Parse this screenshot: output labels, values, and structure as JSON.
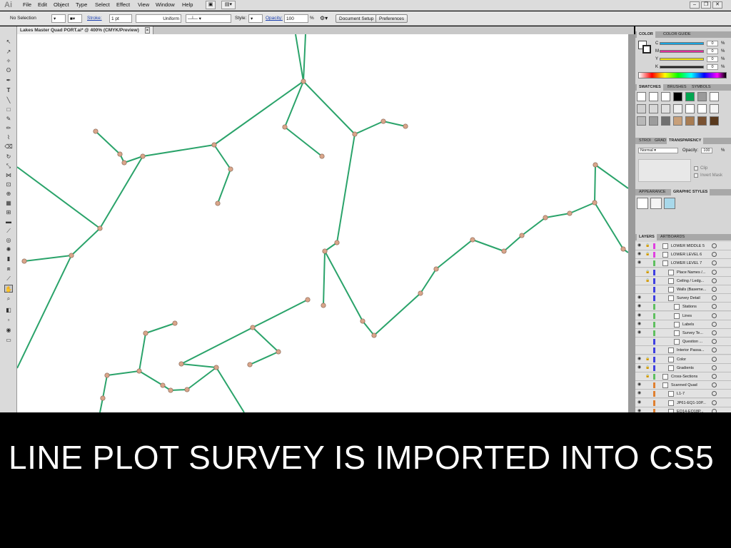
{
  "app": {
    "logo": "Ai"
  },
  "menubar": {
    "items": [
      "File",
      "Edit",
      "Object",
      "Type",
      "Select",
      "Effect",
      "View",
      "Window",
      "Help"
    ],
    "icons": [
      "bridge-icon",
      "arrange-documents-icon"
    ],
    "window_controls": [
      "minimize-icon",
      "restore-icon",
      "close-icon"
    ]
  },
  "control_bar": {
    "selection": "No Selection",
    "stroke_label": "Stroke:",
    "stroke_weight": "1 pt",
    "profile": "Uniform",
    "style_label": "Style:",
    "opacity_label": "Opacity:",
    "opacity_value": "100",
    "opacity_unit": "%",
    "document_setup": "Document Setup",
    "preferences": "Preferences"
  },
  "document_tab": {
    "title": "Lakes Master Quad PORT.ai* @ 400% (CMYK/Preview)",
    "close": "×"
  },
  "panels": {
    "color": {
      "tabs": [
        "COLOR",
        "COLOR GUIDE"
      ],
      "channels": [
        {
          "label": "C",
          "value": "0",
          "unit": "%",
          "color": "#1aa5e0"
        },
        {
          "label": "M",
          "value": "0",
          "unit": "%",
          "color": "#e0309a"
        },
        {
          "label": "Y",
          "value": "0",
          "unit": "%",
          "color": "#f0e010"
        },
        {
          "label": "K",
          "value": "0",
          "unit": "%",
          "color": "#222222"
        }
      ]
    },
    "swatches": {
      "tabs": [
        "SWATCHES",
        "BRUSHES",
        "SYMBOLS"
      ],
      "colors": [
        "#ffffff",
        "#ffffff",
        "#ffffff",
        "#000000",
        "#00a650",
        "#9a9a9a",
        "#ffffff",
        "#d0d0d0",
        "#d8d8d8",
        "#e0e0e0",
        "#f0f0f0",
        "#ffffff",
        "#ffffff",
        "#f4f4f4",
        "#b8b8b8",
        "#9c9c9c",
        "#707070",
        "#c8a07a",
        "#a87c52",
        "#7a5232",
        "#5a3a1e"
      ]
    },
    "transparency": {
      "tabs": [
        "STROI",
        "GRAD",
        "TRANSPARENCY"
      ],
      "blend_mode": "Normal",
      "opacity_label": "Opacity:",
      "opacity_value": "100",
      "opacity_unit": "%",
      "clip": "Clip",
      "invert_mask": "Invert Mask"
    },
    "graphic_styles": {
      "tabs": [
        "APPEARANCE",
        "GRAPHIC STYLES"
      ],
      "styles": [
        "#ffffff",
        "#f4f4f4",
        "#a8d8ea"
      ]
    },
    "layers": {
      "tabs": [
        "LAYERS",
        "ARTBOARDS"
      ],
      "rows": [
        {
          "name": "LOWER MIDDLE 5",
          "color": "#e040e0",
          "lock": true,
          "eye": true
        },
        {
          "name": "LOWER LEVEL 6",
          "color": "#e040e0",
          "lock": true,
          "eye": true
        },
        {
          "name": "LOWER LEVEL 7",
          "color": "#60c060",
          "lock": false,
          "eye": true
        },
        {
          "name": "Place Names /...",
          "color": "#4040e0",
          "lock": true,
          "eye": false
        },
        {
          "name": "Ceiling / Ledg...",
          "color": "#4040e0",
          "lock": true,
          "eye": false
        },
        {
          "name": "Walls (Baseme...",
          "color": "#4040e0",
          "lock": false,
          "eye": false
        },
        {
          "name": "Survey Detail",
          "color": "#4040e0",
          "lock": false,
          "eye": true
        },
        {
          "name": "Stations",
          "color": "#60c060",
          "lock": false,
          "eye": true
        },
        {
          "name": "Lines",
          "color": "#60c060",
          "lock": false,
          "eye": true
        },
        {
          "name": "Labels",
          "color": "#60c060",
          "lock": false,
          "eye": true
        },
        {
          "name": "Survey Te...",
          "color": "#60c060",
          "lock": false,
          "eye": true
        },
        {
          "name": "Question ...",
          "color": "#4040e0",
          "lock": false,
          "eye": false
        },
        {
          "name": "Interior Passa...",
          "color": "#4040e0",
          "lock": false,
          "eye": false
        },
        {
          "name": "Color",
          "color": "#4040e0",
          "lock": true,
          "eye": true
        },
        {
          "name": "Gradients",
          "color": "#4040e0",
          "lock": true,
          "eye": true
        },
        {
          "name": "Cross-Sections",
          "color": "#60c060",
          "lock": true,
          "eye": false
        },
        {
          "name": "Scanned Quad",
          "color": "#e08030",
          "lock": false,
          "eye": true
        },
        {
          "name": "L1-7",
          "color": "#e08030",
          "lock": false,
          "eye": true
        },
        {
          "name": "JP61-EQ1-10P...",
          "color": "#e08030",
          "lock": false,
          "eye": true
        },
        {
          "name": "EQ14-EQ18P...",
          "color": "#e08030",
          "lock": false,
          "eye": true
        }
      ]
    }
  },
  "survey": {
    "line_color": "#2aa36a",
    "station_color": "#d9a58a",
    "segments": [
      [
        [
          390,
          0
        ],
        [
          401,
          66
        ]
      ],
      [
        [
          404,
          0
        ],
        [
          401,
          66
        ]
      ],
      [
        [
          401,
          66
        ],
        [
          276,
          155
        ]
      ],
      [
        [
          401,
          66
        ],
        [
          375,
          130
        ]
      ],
      [
        [
          401,
          66
        ],
        [
          473,
          140
        ]
      ],
      [
        [
          276,
          155
        ],
        [
          176,
          171
        ]
      ],
      [
        [
          276,
          155
        ],
        [
          299,
          189
        ]
      ],
      [
        [
          299,
          189
        ],
        [
          281,
          237
        ]
      ],
      [
        [
          176,
          171
        ],
        [
          150,
          180
        ]
      ],
      [
        [
          176,
          171
        ],
        [
          116,
          272
        ]
      ],
      [
        [
          150,
          180
        ],
        [
          144,
          168
        ]
      ],
      [
        [
          144,
          168
        ],
        [
          110,
          136
        ]
      ],
      [
        [
          116,
          272
        ],
        [
          0,
          186
        ]
      ],
      [
        [
          116,
          272
        ],
        [
          76,
          310
        ]
      ],
      [
        [
          76,
          310
        ],
        [
          10,
          318
        ]
      ],
      [
        [
          76,
          310
        ],
        [
          0,
          468
        ]
      ],
      [
        [
          375,
          130
        ],
        [
          427,
          171
        ]
      ],
      [
        [
          473,
          140
        ],
        [
          513,
          122
        ]
      ],
      [
        [
          513,
          122
        ],
        [
          544,
          129
        ]
      ],
      [
        [
          473,
          140
        ],
        [
          448,
          292
        ]
      ],
      [
        [
          448,
          292
        ],
        [
          431,
          304
        ]
      ],
      [
        [
          431,
          304
        ],
        [
          429,
          380
        ]
      ],
      [
        [
          431,
          304
        ],
        [
          484,
          402
        ]
      ],
      [
        [
          484,
          402
        ],
        [
          500,
          422
        ]
      ],
      [
        [
          500,
          422
        ],
        [
          565,
          363
        ]
      ],
      [
        [
          565,
          363
        ],
        [
          587,
          329
        ]
      ],
      [
        [
          587,
          329
        ],
        [
          638,
          288
        ]
      ],
      [
        [
          638,
          288
        ],
        [
          682,
          304
        ]
      ],
      [
        [
          682,
          304
        ],
        [
          707,
          282
        ]
      ],
      [
        [
          707,
          282
        ],
        [
          740,
          257
        ]
      ],
      [
        [
          740,
          257
        ],
        [
          774,
          251
        ]
      ],
      [
        [
          774,
          251
        ],
        [
          809,
          236
        ]
      ],
      [
        [
          809,
          236
        ],
        [
          810,
          183
        ]
      ],
      [
        [
          810,
          183
        ],
        [
          856,
          216
        ]
      ],
      [
        [
          809,
          236
        ],
        [
          849,
          301
        ]
      ],
      [
        [
          849,
          301
        ],
        [
          856,
          306
        ]
      ],
      [
        [
          407,
          372
        ],
        [
          330,
          411
        ]
      ],
      [
        [
          330,
          411
        ],
        [
          366,
          445
        ]
      ],
      [
        [
          366,
          445
        ],
        [
          326,
          463
        ]
      ],
      [
        [
          330,
          411
        ],
        [
          230,
          462
        ]
      ],
      [
        [
          230,
          462
        ],
        [
          279,
          467
        ]
      ],
      [
        [
          279,
          467
        ],
        [
          238,
          498
        ]
      ],
      [
        [
          238,
          498
        ],
        [
          215,
          499
        ]
      ],
      [
        [
          215,
          499
        ],
        [
          204,
          492
        ]
      ],
      [
        [
          204,
          492
        ],
        [
          171,
          472
        ]
      ],
      [
        [
          171,
          472
        ],
        [
          126,
          478
        ]
      ],
      [
        [
          126,
          478
        ],
        [
          120,
          510
        ]
      ],
      [
        [
          120,
          510
        ],
        [
          116,
          530
        ]
      ],
      [
        [
          171,
          472
        ],
        [
          180,
          419
        ]
      ],
      [
        [
          180,
          419
        ],
        [
          221,
          405
        ]
      ],
      [
        [
          279,
          467
        ],
        [
          318,
          530
        ]
      ]
    ],
    "stations": [
      [
        401,
        66
      ],
      [
        276,
        155
      ],
      [
        299,
        189
      ],
      [
        281,
        237
      ],
      [
        176,
        171
      ],
      [
        150,
        180
      ],
      [
        144,
        168
      ],
      [
        110,
        136
      ],
      [
        116,
        272
      ],
      [
        76,
        310
      ],
      [
        10,
        318
      ],
      [
        375,
        130
      ],
      [
        427,
        171
      ],
      [
        473,
        140
      ],
      [
        513,
        122
      ],
      [
        544,
        129
      ],
      [
        448,
        292
      ],
      [
        431,
        304
      ],
      [
        429,
        380
      ],
      [
        484,
        402
      ],
      [
        500,
        422
      ],
      [
        565,
        363
      ],
      [
        587,
        329
      ],
      [
        638,
        288
      ],
      [
        682,
        304
      ],
      [
        707,
        282
      ],
      [
        740,
        257
      ],
      [
        774,
        251
      ],
      [
        809,
        236
      ],
      [
        810,
        183
      ],
      [
        849,
        301
      ],
      [
        407,
        372
      ],
      [
        330,
        411
      ],
      [
        366,
        445
      ],
      [
        326,
        463
      ],
      [
        230,
        462
      ],
      [
        279,
        467
      ],
      [
        238,
        498
      ],
      [
        215,
        499
      ],
      [
        204,
        492
      ],
      [
        171,
        472
      ],
      [
        126,
        478
      ],
      [
        120,
        510
      ],
      [
        180,
        419
      ],
      [
        221,
        405
      ]
    ]
  },
  "caption": "LINE PLOT SURVEY IS IMPORTED INTO CS5"
}
